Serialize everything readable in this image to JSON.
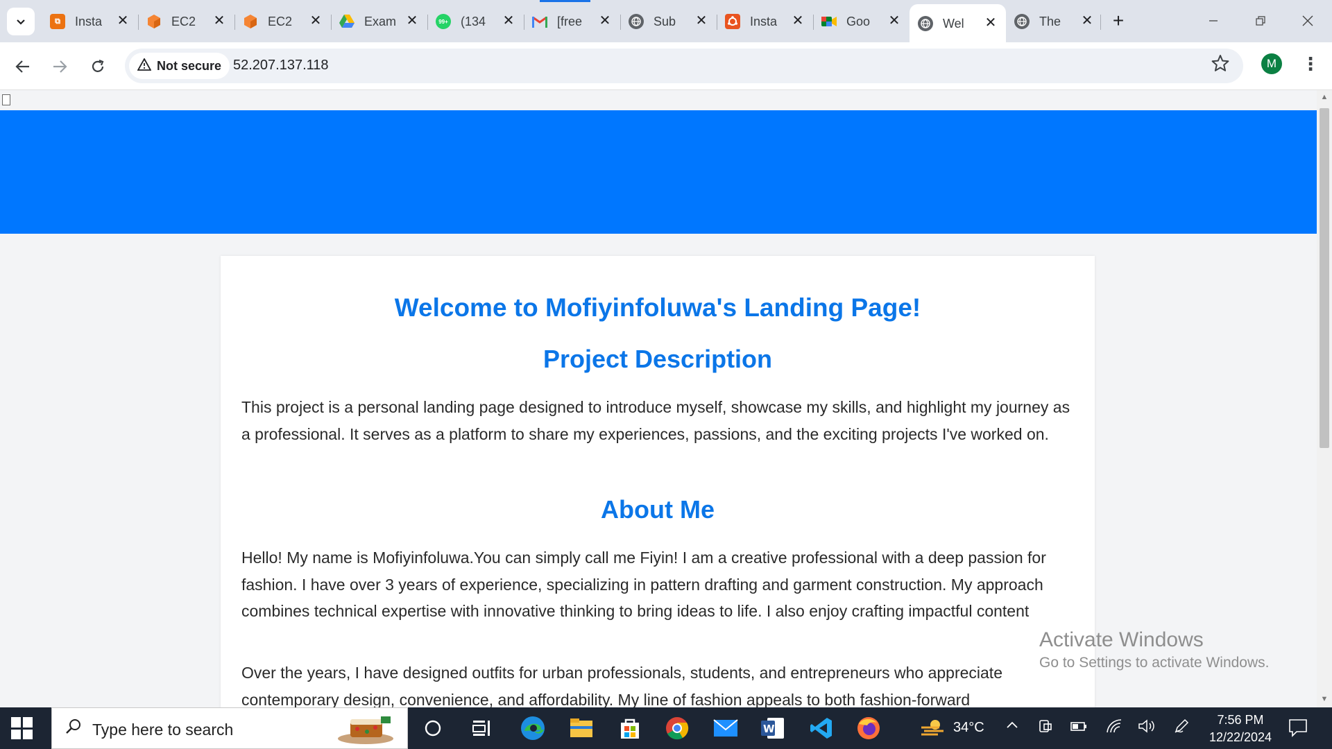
{
  "browser": {
    "tabs": [
      {
        "title": "Insta",
        "icon": "aws-icon",
        "color": "#ec7211",
        "active": false
      },
      {
        "title": "EC2",
        "icon": "ec2-cube-icon",
        "color": "#f58534",
        "active": false
      },
      {
        "title": "EC2",
        "icon": "ec2-cube-icon",
        "color": "#f58534",
        "active": false
      },
      {
        "title": "Exam",
        "icon": "google-drive-icon",
        "color": "#34a853",
        "active": false
      },
      {
        "title": "(134",
        "icon": "whatsapp-icon",
        "color": "#25d366",
        "badge": "99+",
        "active": false
      },
      {
        "title": "[free",
        "icon": "gmail-icon",
        "color": "#ea4335",
        "active": false
      },
      {
        "title": "Sub",
        "icon": "globe-icon",
        "color": "#5f6368",
        "active": false
      },
      {
        "title": "Insta",
        "icon": "ubuntu-icon",
        "color": "#e95420",
        "active": false
      },
      {
        "title": "Goo",
        "icon": "google-meet-icon",
        "color": "#00832d",
        "active": false
      },
      {
        "title": "Wel",
        "icon": "globe-icon",
        "color": "#5f6368",
        "active": true
      },
      {
        "title": "The",
        "icon": "globe-icon",
        "color": "#5f6368",
        "active": false
      }
    ],
    "security_label": "Not secure",
    "url": "52.207.137.118",
    "profile_initial": "M"
  },
  "page": {
    "title": "Welcome to Mofiyinfoluwa's Landing Page!",
    "project_heading": "Project Description",
    "project_text": "This project is a personal landing page designed to introduce myself, showcase my skills, and highlight my journey as a professional. It serves as a platform to share my experiences, passions, and the exciting projects I've worked on.",
    "about_heading": "About Me",
    "about_text_1": "Hello! My name is Mofiyinfoluwa.You can simply call me Fiyin! I am a creative professional with a deep passion for fashion. I have over 3 years of experience, specializing in pattern drafting and garment construction. My approach combines technical expertise with innovative thinking to bring ideas to life. I also enjoy crafting impactful content",
    "about_text_2": "Over the years, I have designed outfits for urban professionals, students, and entrepreneurs who appreciate contemporary design, convenience, and affordability. My line of fashion appeals to both fashion-forward",
    "hero_color": "#0077ff",
    "heading_color": "#0b76e8"
  },
  "watermark": {
    "line1": "Activate Windows",
    "line2": "Go to Settings to activate Windows."
  },
  "taskbar": {
    "search_placeholder": "Type here to search",
    "weather": "34°C",
    "time": "7:56 PM",
    "date": "12/22/2024"
  }
}
